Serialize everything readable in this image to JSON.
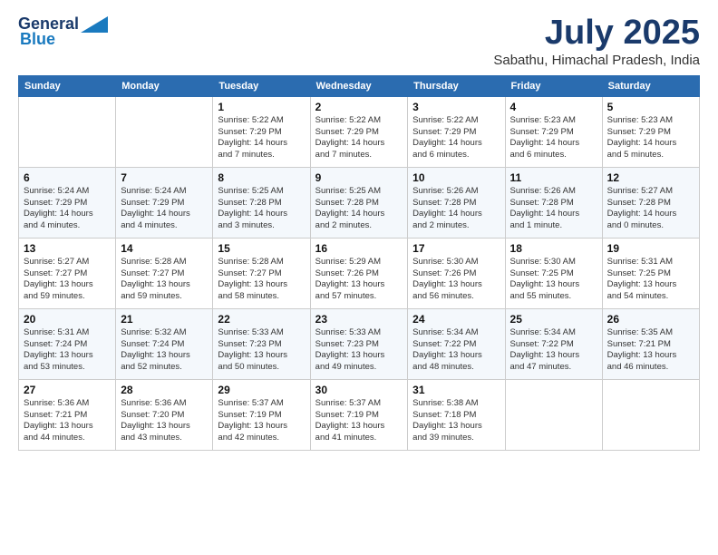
{
  "logo": {
    "line1": "General",
    "line2": "Blue"
  },
  "header": {
    "month": "July 2025",
    "location": "Sabathu, Himachal Pradesh, India"
  },
  "weekdays": [
    "Sunday",
    "Monday",
    "Tuesday",
    "Wednesday",
    "Thursday",
    "Friday",
    "Saturday"
  ],
  "weeks": [
    [
      {
        "day": "",
        "info": ""
      },
      {
        "day": "",
        "info": ""
      },
      {
        "day": "1",
        "info": "Sunrise: 5:22 AM\nSunset: 7:29 PM\nDaylight: 14 hours\nand 7 minutes."
      },
      {
        "day": "2",
        "info": "Sunrise: 5:22 AM\nSunset: 7:29 PM\nDaylight: 14 hours\nand 7 minutes."
      },
      {
        "day": "3",
        "info": "Sunrise: 5:22 AM\nSunset: 7:29 PM\nDaylight: 14 hours\nand 6 minutes."
      },
      {
        "day": "4",
        "info": "Sunrise: 5:23 AM\nSunset: 7:29 PM\nDaylight: 14 hours\nand 6 minutes."
      },
      {
        "day": "5",
        "info": "Sunrise: 5:23 AM\nSunset: 7:29 PM\nDaylight: 14 hours\nand 5 minutes."
      }
    ],
    [
      {
        "day": "6",
        "info": "Sunrise: 5:24 AM\nSunset: 7:29 PM\nDaylight: 14 hours\nand 4 minutes."
      },
      {
        "day": "7",
        "info": "Sunrise: 5:24 AM\nSunset: 7:29 PM\nDaylight: 14 hours\nand 4 minutes."
      },
      {
        "day": "8",
        "info": "Sunrise: 5:25 AM\nSunset: 7:28 PM\nDaylight: 14 hours\nand 3 minutes."
      },
      {
        "day": "9",
        "info": "Sunrise: 5:25 AM\nSunset: 7:28 PM\nDaylight: 14 hours\nand 2 minutes."
      },
      {
        "day": "10",
        "info": "Sunrise: 5:26 AM\nSunset: 7:28 PM\nDaylight: 14 hours\nand 2 minutes."
      },
      {
        "day": "11",
        "info": "Sunrise: 5:26 AM\nSunset: 7:28 PM\nDaylight: 14 hours\nand 1 minute."
      },
      {
        "day": "12",
        "info": "Sunrise: 5:27 AM\nSunset: 7:28 PM\nDaylight: 14 hours\nand 0 minutes."
      }
    ],
    [
      {
        "day": "13",
        "info": "Sunrise: 5:27 AM\nSunset: 7:27 PM\nDaylight: 13 hours\nand 59 minutes."
      },
      {
        "day": "14",
        "info": "Sunrise: 5:28 AM\nSunset: 7:27 PM\nDaylight: 13 hours\nand 59 minutes."
      },
      {
        "day": "15",
        "info": "Sunrise: 5:28 AM\nSunset: 7:27 PM\nDaylight: 13 hours\nand 58 minutes."
      },
      {
        "day": "16",
        "info": "Sunrise: 5:29 AM\nSunset: 7:26 PM\nDaylight: 13 hours\nand 57 minutes."
      },
      {
        "day": "17",
        "info": "Sunrise: 5:30 AM\nSunset: 7:26 PM\nDaylight: 13 hours\nand 56 minutes."
      },
      {
        "day": "18",
        "info": "Sunrise: 5:30 AM\nSunset: 7:25 PM\nDaylight: 13 hours\nand 55 minutes."
      },
      {
        "day": "19",
        "info": "Sunrise: 5:31 AM\nSunset: 7:25 PM\nDaylight: 13 hours\nand 54 minutes."
      }
    ],
    [
      {
        "day": "20",
        "info": "Sunrise: 5:31 AM\nSunset: 7:24 PM\nDaylight: 13 hours\nand 53 minutes."
      },
      {
        "day": "21",
        "info": "Sunrise: 5:32 AM\nSunset: 7:24 PM\nDaylight: 13 hours\nand 52 minutes."
      },
      {
        "day": "22",
        "info": "Sunrise: 5:33 AM\nSunset: 7:23 PM\nDaylight: 13 hours\nand 50 minutes."
      },
      {
        "day": "23",
        "info": "Sunrise: 5:33 AM\nSunset: 7:23 PM\nDaylight: 13 hours\nand 49 minutes."
      },
      {
        "day": "24",
        "info": "Sunrise: 5:34 AM\nSunset: 7:22 PM\nDaylight: 13 hours\nand 48 minutes."
      },
      {
        "day": "25",
        "info": "Sunrise: 5:34 AM\nSunset: 7:22 PM\nDaylight: 13 hours\nand 47 minutes."
      },
      {
        "day": "26",
        "info": "Sunrise: 5:35 AM\nSunset: 7:21 PM\nDaylight: 13 hours\nand 46 minutes."
      }
    ],
    [
      {
        "day": "27",
        "info": "Sunrise: 5:36 AM\nSunset: 7:21 PM\nDaylight: 13 hours\nand 44 minutes."
      },
      {
        "day": "28",
        "info": "Sunrise: 5:36 AM\nSunset: 7:20 PM\nDaylight: 13 hours\nand 43 minutes."
      },
      {
        "day": "29",
        "info": "Sunrise: 5:37 AM\nSunset: 7:19 PM\nDaylight: 13 hours\nand 42 minutes."
      },
      {
        "day": "30",
        "info": "Sunrise: 5:37 AM\nSunset: 7:19 PM\nDaylight: 13 hours\nand 41 minutes."
      },
      {
        "day": "31",
        "info": "Sunrise: 5:38 AM\nSunset: 7:18 PM\nDaylight: 13 hours\nand 39 minutes."
      },
      {
        "day": "",
        "info": ""
      },
      {
        "day": "",
        "info": ""
      }
    ]
  ]
}
